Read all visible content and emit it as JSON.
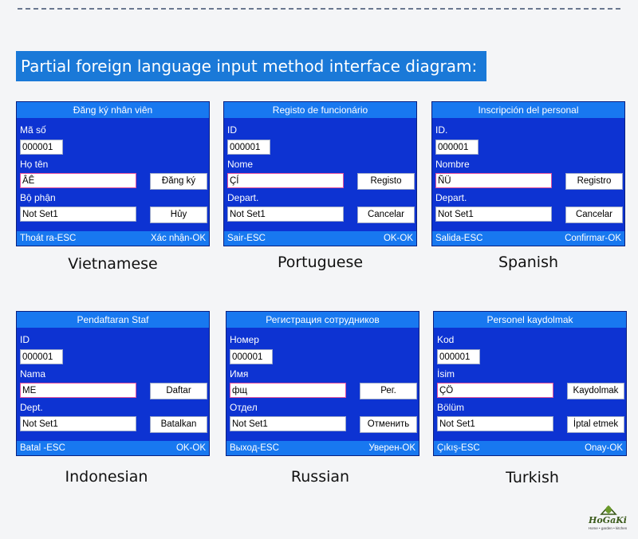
{
  "banner": "Partial foreign language input method interface diagram:",
  "colors": {
    "screen_bg": "#0d33d2",
    "bar_bg": "#1878f0",
    "banner_bg": "#1a79d8",
    "name_border": "#e2519f"
  },
  "panels": [
    {
      "caption": "Vietnamese",
      "title": "Đăng ký nhân viên",
      "id_label": "Mã số",
      "id_value": "000001",
      "name_label": "Họ tên",
      "name_value": "ÂÊ",
      "dept_label": "Bộ phận",
      "dept_value": "Not Set1",
      "btn1": "Đăng ký",
      "btn2": "Hủy",
      "left_status": "Thoát ra-ESC",
      "right_status": "Xác nhận-OK"
    },
    {
      "caption": "Portuguese",
      "title": "Registo de funcionário",
      "id_label": "ID",
      "id_value": "000001",
      "name_label": "Nome",
      "name_value": "ÇÍ",
      "dept_label": "Depart.",
      "dept_value": "Not Set1",
      "btn1": "Registo",
      "btn2": "Cancelar",
      "left_status": "Sair-ESC",
      "right_status": "OK-OK"
    },
    {
      "caption": "Spanish",
      "title": "Inscripción del personal",
      "id_label": "ID.",
      "id_value": "000001",
      "name_label": "Nombre",
      "name_value": "ÑÜ",
      "dept_label": "Depart.",
      "dept_value": "Not Set1",
      "btn1": "Registro",
      "btn2": "Cancelar",
      "left_status": "Salida-ESC",
      "right_status": "Confirmar-OK"
    },
    {
      "caption": "Indonesian",
      "title": "Pendaftaran Staf",
      "id_label": "ID",
      "id_value": "000001",
      "name_label": "Nama",
      "name_value": "ME",
      "dept_label": "Dept.",
      "dept_value": "Not Set1",
      "btn1": "Daftar",
      "btn2": "Batalkan",
      "left_status": "Batal -ESC",
      "right_status": "OK-OK"
    },
    {
      "caption": "Russian",
      "title": "Регистрация сотрудников",
      "id_label": "Номер",
      "id_value": "000001",
      "name_label": "Имя",
      "name_value": "фщ",
      "dept_label": "Отдел",
      "dept_value": "Not Set1",
      "btn1": "Рег.",
      "btn2": "Отменить",
      "left_status": "Выход-ESC",
      "right_status": "Уверен-OK"
    },
    {
      "caption": "Turkish",
      "title": "Personel kaydolmak",
      "id_label": "Kod",
      "id_value": "000001",
      "name_label": "İsim",
      "name_value": "ÇÖ",
      "dept_label": "Bölüm",
      "dept_value": "Not Set1",
      "btn1": "Kaydolmak",
      "btn2": "İptal etmek",
      "left_status": "Çıkış-ESC",
      "right_status": "Onay-OK"
    }
  ],
  "logo": {
    "brand": "HoGaKi",
    "tagline": "Home • garden • kitchen",
    "icon": "leaf-house-icon"
  }
}
